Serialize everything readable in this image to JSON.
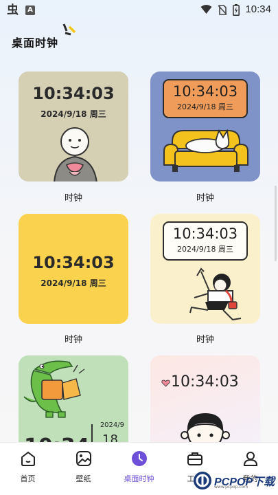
{
  "status_bar": {
    "app_icon_1": "虫",
    "app_icon_2": "A",
    "time": "10:34",
    "icons": [
      "wifi-icon",
      "no-sim-icon",
      "battery-charging-icon"
    ]
  },
  "header": {
    "title": "桌面时钟"
  },
  "cards": [
    {
      "time": "10:34:03",
      "date": "2024/9/18 周三",
      "label": "时钟",
      "bg": "#d5cfb4"
    },
    {
      "time": "10:34:03",
      "date": "2024/9/18 周三",
      "label": "时钟",
      "bg": "#7f93c8",
      "box": "#ef9c5a"
    },
    {
      "time": "10:34:03",
      "date": "2024/9/18 周三",
      "label": "时钟",
      "bg": "#fbd24e"
    },
    {
      "time": "10:34:03",
      "date": "2024/9/18 周三",
      "label": "时钟",
      "bg": "#fbf0cc"
    },
    {
      "date_partial": "2024/9",
      "time_partial": "10:34",
      "time_partial_right": "18",
      "bg": "#bfe0b9"
    },
    {
      "time": "10:34:03",
      "bg": "#fde7e3"
    }
  ],
  "tab_bar": {
    "active_color": "#6d4fd8",
    "tabs": [
      {
        "label": "首页",
        "icon": "home-icon"
      },
      {
        "label": "壁纸",
        "icon": "wallpaper-icon"
      },
      {
        "label": "桌面时钟",
        "icon": "clock-icon",
        "active": true
      },
      {
        "label": "工具",
        "icon": "toolbox-icon"
      },
      {
        "label": "我的",
        "icon": "profile-icon"
      }
    ]
  },
  "watermark": {
    "text": "PCPOP下载",
    "sub": "www.pcpop.com"
  }
}
